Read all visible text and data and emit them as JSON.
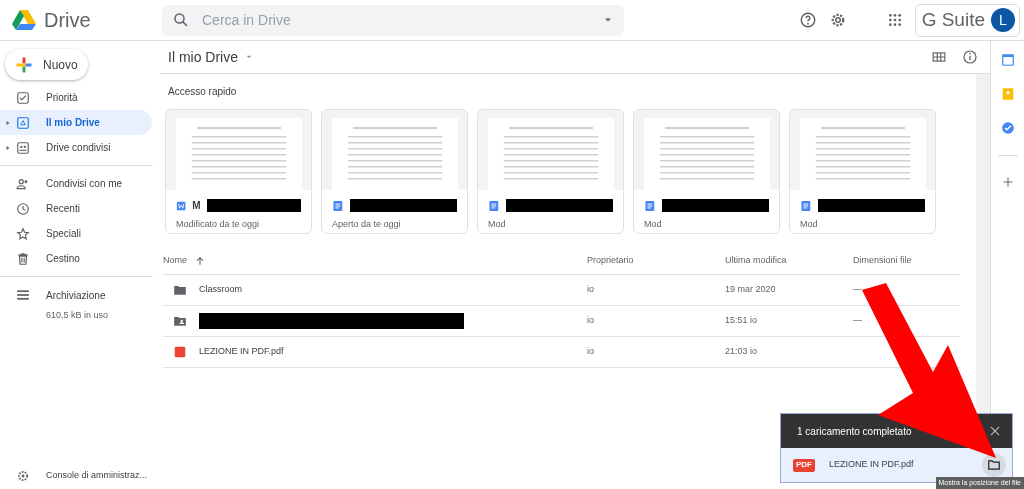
{
  "header": {
    "app_name": "Drive",
    "search": {
      "placeholder": "Cerca in Drive"
    },
    "suite_label": "G Suite",
    "avatar_letter": "L"
  },
  "sidebar": {
    "new_button": "Nuovo",
    "items": [
      {
        "label": "Priorità",
        "selected": false
      },
      {
        "label": "Il mio Drive",
        "selected": true
      },
      {
        "label": "Drive condivisi",
        "selected": false
      },
      {
        "label": "Condivisi con me",
        "selected": false
      },
      {
        "label": "Recenti",
        "selected": false
      },
      {
        "label": "Speciali",
        "selected": false
      },
      {
        "label": "Cestino",
        "selected": false
      }
    ],
    "storage": {
      "label": "Archiviazione",
      "usage": "610,5 kB in uso"
    },
    "admin_link": "Console di amministraz..."
  },
  "main": {
    "title": "Il mio Drive",
    "quick_access": {
      "title": "Accesso rapido",
      "cards": [
        {
          "kind": "word",
          "title": "M",
          "subtitle": "Modificato da te oggi"
        },
        {
          "kind": "doc",
          "subtitle": "Aperto da te oggi"
        },
        {
          "kind": "doc",
          "subtitle": "Mod"
        },
        {
          "kind": "doc",
          "subtitle": "Mod"
        },
        {
          "kind": "doc",
          "subtitle": "Mod"
        }
      ]
    },
    "table": {
      "columns": [
        "Nome",
        "Proprietario",
        "Ultima modifica",
        "Dimensioni file"
      ],
      "rows": [
        {
          "kind": "folder",
          "name": "Classroom",
          "owner": "io",
          "modified": "19 mar 2020",
          "size": "—"
        },
        {
          "kind": "shared-folder",
          "owner": "io",
          "modified": "15:51 io",
          "size": "—"
        },
        {
          "kind": "pdf",
          "name": "LEZIONE IN PDF.pdf",
          "owner": "io",
          "modified": "21:03 io"
        }
      ]
    }
  },
  "upload_panel": {
    "title": "1 caricamento completato",
    "file": {
      "kind": "pdf",
      "name": "LEZIONE IN PDF.pdf",
      "badge": "PDF"
    },
    "tooltip": "Mostra la posizione del file"
  }
}
